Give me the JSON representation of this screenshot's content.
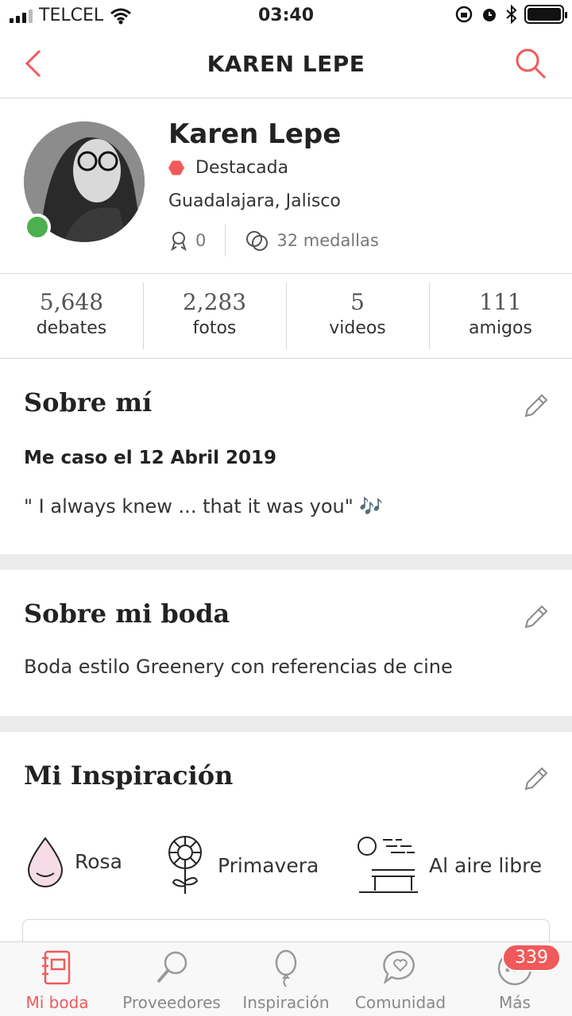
{
  "status_bar": {
    "carrier": "TELCEL",
    "time": "03:40"
  },
  "header": {
    "title": "KAREN LEPE"
  },
  "profile": {
    "name": "Karen Lepe",
    "badge": "Destacada",
    "location": "Guadalajara, Jalisco",
    "awards": "0",
    "medals": "32 medallas"
  },
  "counts": [
    {
      "num": "5,648",
      "label": "debates"
    },
    {
      "num": "2,283",
      "label": "fotos"
    },
    {
      "num": "5",
      "label": "videos"
    },
    {
      "num": "111",
      "label": "amigos"
    }
  ],
  "about": {
    "title": "Sobre mí",
    "subtitle": "Me caso el 12 Abril 2019",
    "text": "\" I always knew ... that it was you\" 🎶"
  },
  "wedding": {
    "title": "Sobre mi boda",
    "text": "Boda estilo Greenery con referencias de cine"
  },
  "inspiration": {
    "title": "Mi Inspiración",
    "items": [
      {
        "label": "Rosa",
        "icon": "drop-icon"
      },
      {
        "label": "Primavera",
        "icon": "flower-icon"
      },
      {
        "label": "Al aire libre",
        "icon": "park-bench-icon"
      }
    ]
  },
  "tabs": [
    {
      "label": "Mi boda",
      "icon": "notebook-icon",
      "active": true
    },
    {
      "label": "Proveedores",
      "icon": "magnifier-icon"
    },
    {
      "label": "Inspiración",
      "icon": "balloon-icon"
    },
    {
      "label": "Comunidad",
      "icon": "chat-heart-icon"
    },
    {
      "label": "Más",
      "icon": "more-icon",
      "badge": "339"
    }
  ],
  "colors": {
    "accent": "#f05a5a",
    "online": "#4caf50"
  }
}
